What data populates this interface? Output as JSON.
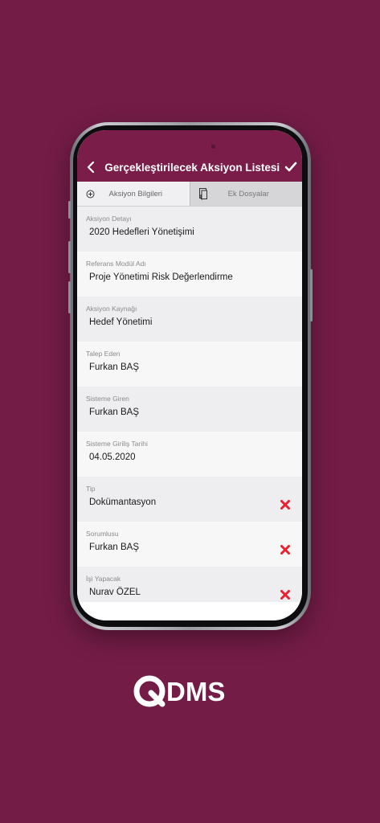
{
  "header": {
    "title": "Gerçekleştirilecek Aksiyon Listesi"
  },
  "tabs": [
    {
      "label": "Aksiyon Bilgileri",
      "icon": "plus-circle-icon"
    },
    {
      "label": "Ek Dosyalar",
      "icon": "document-attachment-icon"
    }
  ],
  "fields": [
    {
      "label": "Aksiyon Detayı",
      "value": "2020 Hedefleri Yönetişimi"
    },
    {
      "label": "Referans Modül Adı",
      "value": "Proje Yönetimi Risk Değerlendirme"
    },
    {
      "label": "Aksiyon Kaynağı",
      "value": "Hedef Yönetimi"
    },
    {
      "label": "Talep Eden",
      "value": "Furkan BAŞ"
    },
    {
      "label": "Sisteme Giren",
      "value": "Furkan BAŞ"
    },
    {
      "label": "Sisteme Giriliş Tarihi",
      "value": "04.05.2020"
    },
    {
      "label": "Tip",
      "value": "Dokümantasyon",
      "removable": true
    },
    {
      "label": "Sorumlusu",
      "value": "Furkan BAŞ",
      "removable": true
    },
    {
      "label": "İşi Yapacak",
      "value": "Nurav ÖZEL",
      "removable": true
    }
  ],
  "brand": {
    "logo_text": "DMS",
    "color": "#731c46",
    "accent": "#7a1d49",
    "delete_color": "#e8232f"
  }
}
